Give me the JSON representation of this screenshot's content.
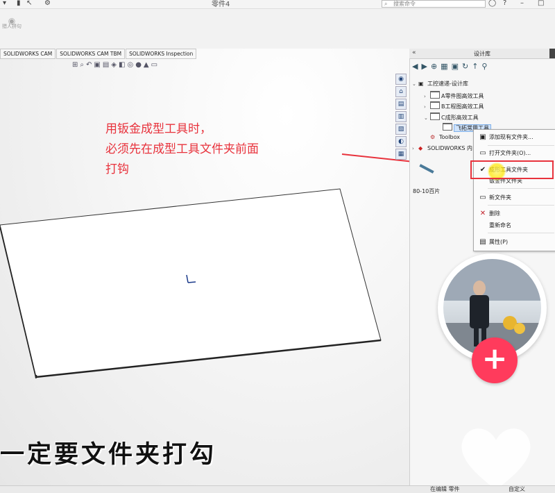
{
  "window": {
    "title": "零件4",
    "search_placeholder": "搜索命令",
    "watermark": "猎人拼句"
  },
  "command_tabs": [
    "SOLIDWORKS CAM",
    "SOLIDWORKS CAM TBM",
    "SOLIDWORKS Inspection"
  ],
  "annotation": {
    "line1": "用钣金成型工具时，",
    "line2": "必须先在成型工具文件夹前面",
    "line3": "打钩",
    "color": "#e8323c"
  },
  "subtitle": "一定要文件夹打勾",
  "panel": {
    "title": "设计库",
    "tree": {
      "root": "工控速递-设计库",
      "a": "A零件图高效工具",
      "b": "B工程图高效工具",
      "c": "C成形高效工具",
      "selected": "飞拓常用工具",
      "toolbox": "Toolbox",
      "content": "SOLIDWORKS 内"
    },
    "thumb_label": "80-10百片"
  },
  "context_menu": {
    "add_folder": "添加现有文件夹...",
    "open_folder": "打开文件夹(O)...",
    "forming_tools": "成形工具文件夹",
    "sheet_metal": "钣金件文件夹",
    "new_folder": "新文件夹",
    "delete": "删除",
    "rename": "重新命名",
    "properties": "属性(P)"
  },
  "status": {
    "editing": "在编辑 零件",
    "custom": "自定义"
  },
  "colors": {
    "accent_red": "#e8323c",
    "plus_button": "#ff3b5c",
    "selection_blue": "#cfe3fb"
  }
}
